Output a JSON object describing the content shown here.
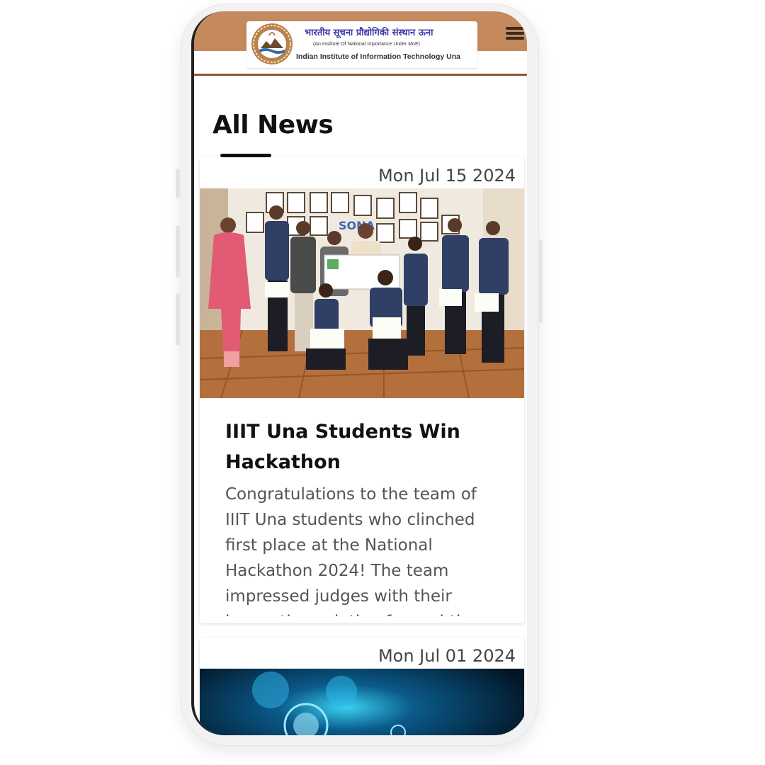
{
  "header": {
    "hindi_name": "भारतीय सूचना प्रौद्योगिकी संस्थान ऊना",
    "subtitle": "(An Institute Of National Importance Under MoE)",
    "english_name": "Indian Institute of Information Technology Una",
    "menu_icon": "hamburger-menu-icon"
  },
  "page": {
    "title": "All News"
  },
  "news": [
    {
      "date": "Mon Jul 15 2024",
      "title": "IIIT Una Students Win Hackathon",
      "summary": "Congratulations to the team of IIIT Una students who clinched first place at the National Hackathon 2024! The team impressed judges with their innovative solution for real-time",
      "image": "group-photo-students-with-certificates"
    },
    {
      "date": "Mon Jul 01 2024",
      "image": "blue-technology-abstract"
    }
  ],
  "colors": {
    "header_brown": "#c48a5e",
    "header_line": "#8a5a3a",
    "logo_blue": "#3a3aa8"
  }
}
